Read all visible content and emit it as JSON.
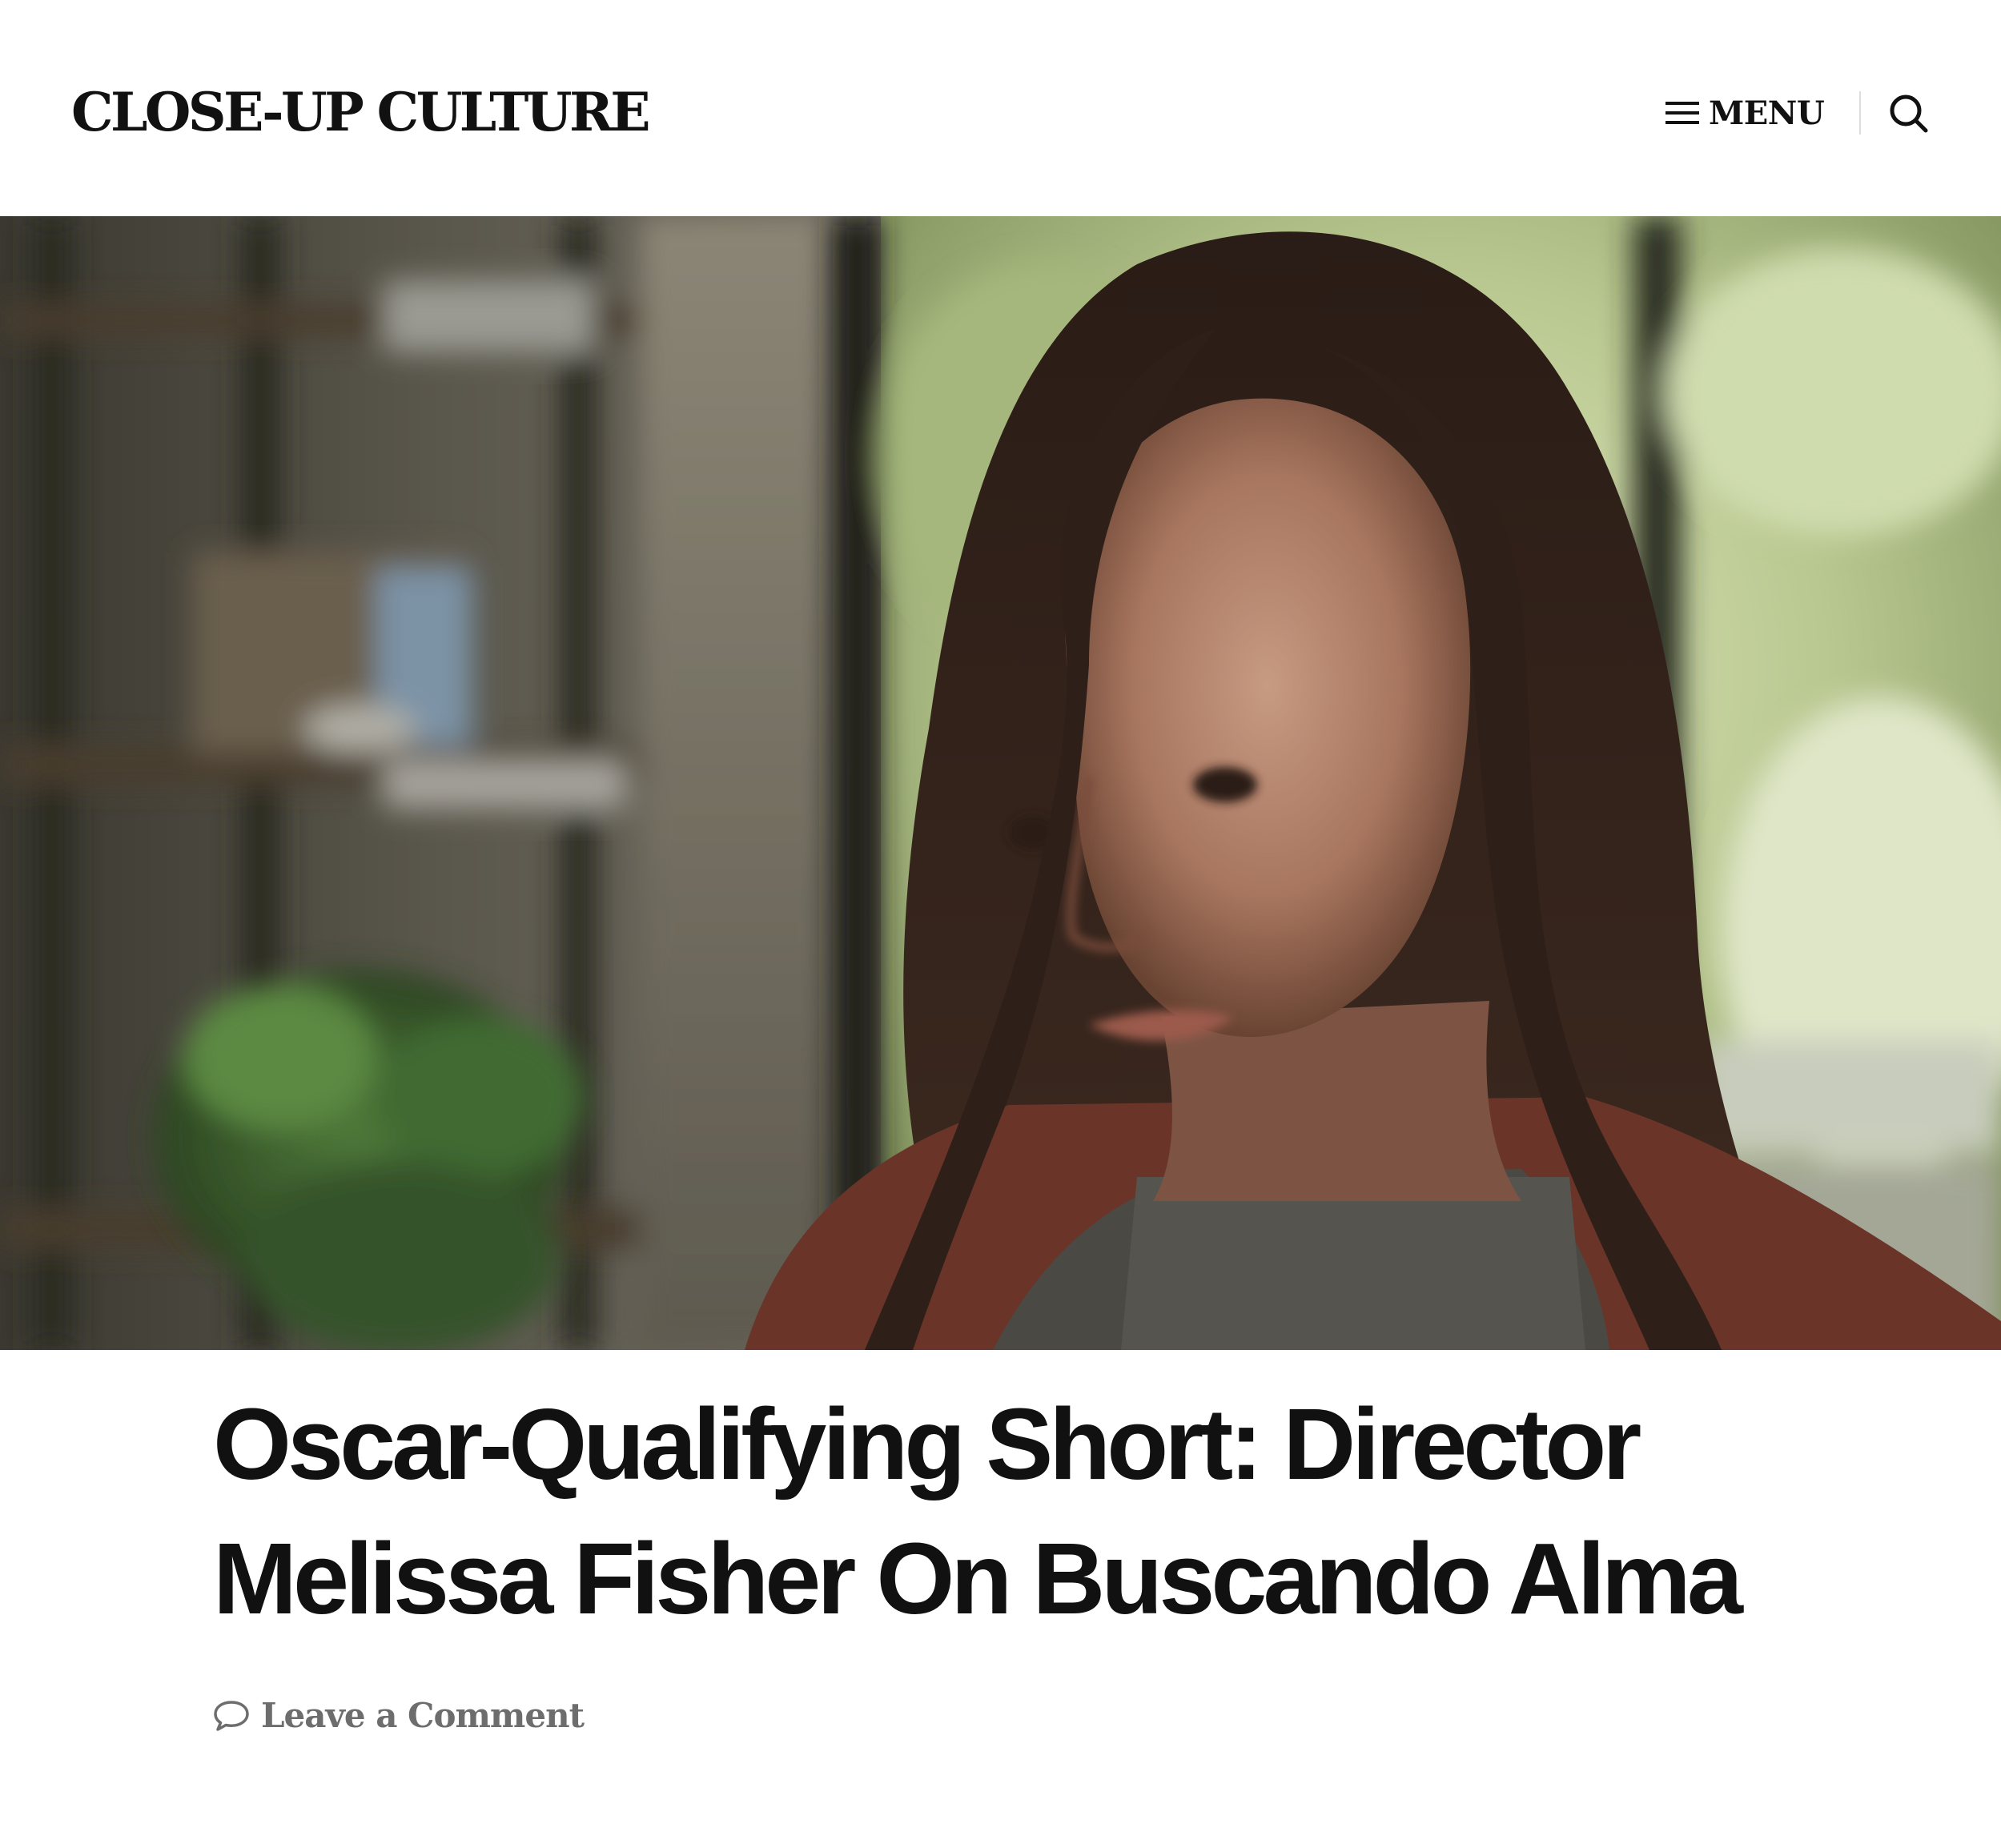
{
  "site": {
    "title": "CLOSE-UP CULTURE"
  },
  "header": {
    "menu_label": "MENU",
    "menu_icon": "hamburger-icon",
    "search_icon": "search-icon"
  },
  "featured_image": {
    "alt": "Film still of a woman with long dark hair in a softly lit room"
  },
  "article": {
    "title": "Oscar-Qualifying Short: Director Melissa Fisher On Buscando Alma",
    "comment_link": "Leave a Comment",
    "comment_icon": "speech-bubble-icon"
  },
  "colors": {
    "text": "#111111",
    "meta_text": "#6d6d6d",
    "divider": "#dddddd",
    "background": "#ffffff"
  }
}
